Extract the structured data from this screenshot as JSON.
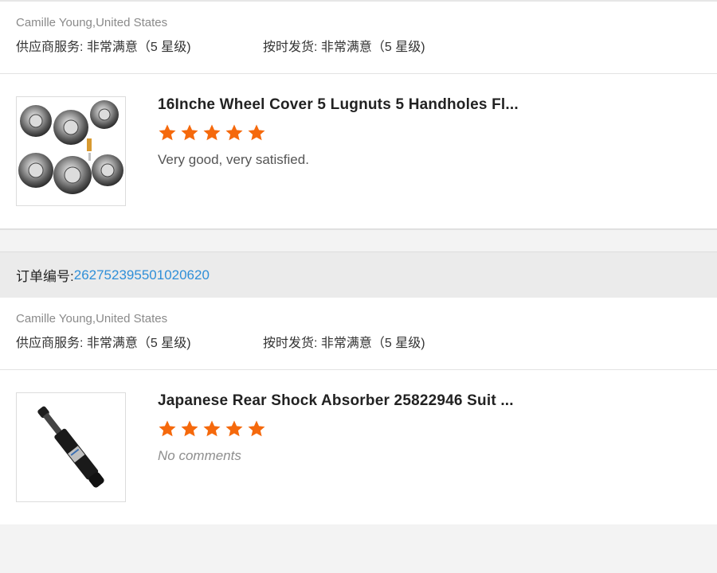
{
  "colors": {
    "star": "#f5690c",
    "order_link": "#2f8fd8"
  },
  "reviews": [
    {
      "reviewer": "Camille Young,United States",
      "supplier_service": "供应商服务: 非常满意（5 星级)",
      "on_time_delivery": "按时发货: 非常满意（5 星级)",
      "product_title": "16Inche Wheel Cover 5 Lugnuts 5 Handholes Fl...",
      "stars": 5,
      "comment": "Very good, very satisfied.",
      "image": "wheel-covers"
    },
    {
      "reviewer": "Camille Young,United States",
      "supplier_service": "供应商服务: 非常满意（5 星级)",
      "on_time_delivery": "按时发货: 非常满意（5 星级)",
      "product_title": "Japanese Rear Shock Absorber 25822946 Suit ...",
      "stars": 5,
      "comment": "No comments",
      "image": "shock-absorber"
    }
  ],
  "order": {
    "label": "订单编号:",
    "number": "262752395501020620"
  }
}
